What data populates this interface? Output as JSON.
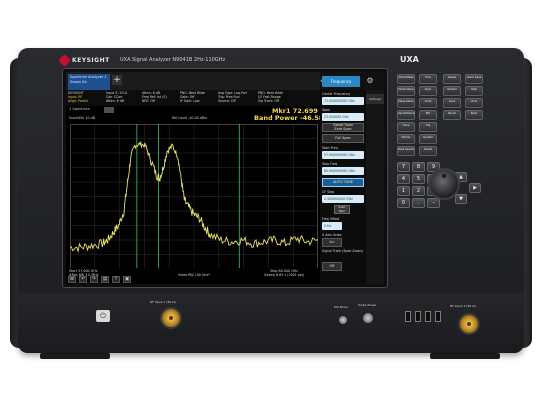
{
  "instrument": {
    "brand": "KEYSIGHT",
    "model": "UXA Signal Analyzer",
    "model_suffix": "N9041B  2Hz-110GHz",
    "series_label": "UXA"
  },
  "screen": {
    "tab_mode": {
      "line1": "Spectrum Analyzer 1",
      "line2": "Swept SA"
    },
    "tab_add": "+",
    "measurement_bar": [
      {
        "line1": "KEYSIGHT",
        "line2": "Input: RF",
        "line3": "Align: Partial"
      },
      {
        "line1": "Input Z: 50 Ω",
        "line2": "Corr CCorr",
        "line3": "Atten: 6 dB"
      },
      {
        "line1": "Atten: 6 dB",
        "line2": "Freq Ref: Int (S)",
        "line3": "NFE: Off"
      },
      {
        "line1": "PNO: Best Wide",
        "line2": "Gate: Off",
        "line3": "IF Gain: Low"
      },
      {
        "line1": "Avg Type: Log-Pwr",
        "line2": "Trig: Free Run",
        "line3": "Source: Off"
      },
      {
        "line1": "PNO: Best Wide",
        "line2": "LO Fast Range",
        "line3": "Sig Track: Off"
      }
    ],
    "trace_header": "1 Spectrum",
    "scale_label": "Scale/Div 10 dB",
    "ref_label": "Ref Level -40.00 dBm",
    "marker_readout": "Mkr1 72.699 GHz",
    "band_power": "Band Power  -46.58 dBm",
    "sidebar_top_button": "Frequency",
    "gear_icon": "gear-icon",
    "bottom_status": {
      "center": "Start 57.000 GHz",
      "res_bw": "#Res BW 3.0 MHz",
      "video_bw": "Video BW 100 kHz*",
      "stop": "Stop 80.000 GHz",
      "sweep": "Sweep 6.65 s (1001 pts)"
    },
    "side_panel": {
      "center_freq_label": "Center Frequency",
      "center_freq_value": "71.000000000 GHz",
      "span_label": "Span",
      "span_value": "23.000000 GHz",
      "swept_span": "Swept Span",
      "zero_span": "Zero Span",
      "full_span": "Full Span",
      "start_freq_label": "Start Freq",
      "start_freq_value": "57.000000000 GHz",
      "stop_freq_label": "Stop Freq",
      "stop_freq_value": "80.000000000 GHz",
      "auto_tune": "AUTO TUNE",
      "cf_step_label": "CF Step",
      "cf_step_value": "2.300000000 GHz",
      "auto_label": "Auto",
      "man_label": "Man",
      "freq_offset_label": "Freq Offset",
      "freq_offset_value": "0 Hz",
      "x_axis_scale_label": "X Axis Scale",
      "x_axis_scale_value": "Lin",
      "signal_track_label": "Signal Track (Span Zoom)",
      "signal_track_value": "Off",
      "strip_settings": "Settings"
    }
  },
  "chart_data": {
    "type": "line",
    "xlim": [
      57,
      80
    ],
    "ylim": [
      -120,
      -40
    ],
    "grid": true,
    "series": [
      {
        "x": [
          57,
          58,
          59,
          60,
          60.5,
          61,
          61.5,
          62,
          62.3,
          62.6,
          63,
          63.5,
          64,
          64.5,
          65,
          65.3,
          65.6,
          66,
          66.5,
          67,
          67.3,
          67.6,
          68,
          68.5,
          69,
          69.5,
          70,
          71,
          72,
          73,
          74,
          75,
          76,
          77,
          78,
          79,
          80
        ],
        "y": [
          -108,
          -108,
          -107,
          -106,
          -104,
          -100,
          -96,
          -88,
          -74,
          -60,
          -52,
          -51,
          -52,
          -60,
          -68,
          -70,
          -65,
          -55,
          -52,
          -58,
          -70,
          -82,
          -86,
          -90,
          -92,
          -97,
          -101,
          -104,
          -105,
          -104,
          -106,
          -105,
          -104,
          -106,
          -103,
          -105,
          -104
        ]
      }
    ],
    "markers": [
      63.2,
      65.2,
      72.7
    ]
  },
  "front_panel": {
    "hard_keys_left": [
      "Mode/Meas",
      "Mode Setup",
      "Meas Setup",
      "Input/Output",
      "Trace",
      "Marker",
      "Peak Search",
      "Sweep",
      "Restart",
      "Save",
      "Recall"
    ],
    "hard_keys_right": [
      "Freq",
      "Span",
      "Ampt",
      "BW",
      "Trig",
      "System",
      "Preset",
      "Quick Save",
      "Help",
      "Undo",
      "Redo"
    ],
    "numpad": [
      "7",
      "8",
      "9",
      "4",
      "5",
      "6",
      "1",
      "2",
      "3",
      "0",
      ".",
      "-"
    ],
    "arrow_up": "▲",
    "arrow_down": "▼",
    "arrow_left": "◀",
    "arrow_right": "▶",
    "power_symbol": "⏻"
  },
  "bottom_panel": {
    "rf_input_label": "RF Input 1 (50 Ω)",
    "rf_output_label": "RF Input 2 (50 Ω)",
    "probe_power_label": "Probe Power",
    "ext_mixer_label": "Ext Mixer"
  }
}
